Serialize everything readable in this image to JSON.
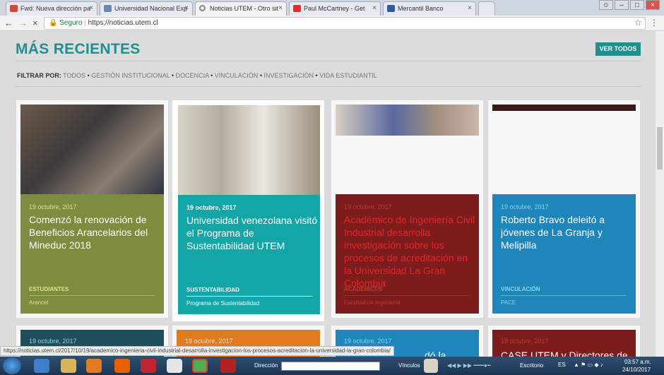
{
  "browser": {
    "tabs": [
      {
        "title": "Fwd: Nueva dirección pa",
        "icon": "gmail-icon",
        "color": "#d44638"
      },
      {
        "title": "Universidad Nacional Exp",
        "icon": "document-icon",
        "color": "#6b87b8"
      },
      {
        "title": "Noticias UTEM - Otro sit",
        "icon": "loading-icon",
        "color": "#888888"
      },
      {
        "title": "Paul McCartney - Get",
        "icon": "youtube-icon",
        "color": "#e52d27"
      },
      {
        "title": "Mercantil Banco",
        "icon": "bank-icon",
        "color": "#2f5d9a"
      }
    ],
    "secure_label": "Seguro",
    "url": "https://noticias.utem.cl",
    "status_url": "https://noticias.utem.cl/2017/10/19/academico-ingenieria-civil-industrial-desarrolla-investigacion-los-procesos-acreditacion-la-universidad-la-gran-colombia/"
  },
  "page": {
    "heading": "MÁS RECIENTES",
    "ver_todos": "VER TODOS",
    "filter_label": "FILTRAR POR:",
    "filters": [
      "TODOS",
      "GESTIÓN INSTITUCIONAL",
      "DOCENCIA",
      "VINCULACIÓN",
      "INVESTIGACIÓN",
      "VIDA ESTUDIANTIL"
    ],
    "separator": "•"
  },
  "cards": [
    {
      "date": "19 octubre, 2017",
      "title": "Comenzó la renovación de Beneficios Arancelarios del Mineduc 2018",
      "category": "ESTUDIANTES",
      "sub": "Arancel",
      "bg": "#7d8c3e",
      "date_color": "#e3e08e",
      "title_color": "#ffffff",
      "cat_color": "#e3e08e"
    },
    {
      "date": "19 octubre, 2017",
      "title": "Universidad venezolana visitó el Programa de Sustentabilidad UTEM",
      "category": "SUSTENTABILIDAD",
      "sub": "Programa de Sustentabilidad",
      "bg": "#14a6a6",
      "date_color": "#ffffff",
      "title_color": "#ffffff",
      "cat_color": "#ffffff"
    },
    {
      "date": "19 octubre, 2017",
      "title": "Académico de Ingeniería Civil Industrial desarrolla investigación sobre los procesos de acreditación en la Universidad La Gran Colombia",
      "category": "ACADÉMICOS",
      "sub": "Facultad de Ingeniería",
      "bg": "#7d1c1c",
      "date_color": "#c0392b",
      "title_color": "#e3262a",
      "cat_color": "#c0392b"
    },
    {
      "date": "19 octubre, 2017",
      "title": "Roberto Bravo deleitó a jóvenes de La Granja y Melipilla",
      "category": "VINCULACIÓN",
      "sub": "PACE",
      "bg": "#1f86b9",
      "date_color": "#8fd3f0",
      "title_color": "#ffffff",
      "cat_color": "#8fd3f0"
    }
  ],
  "cards_row2": [
    {
      "date": "19 octubre, 2017",
      "title": "",
      "bg": "#1f4f5a",
      "date_color": "#8fd3f0"
    },
    {
      "date": "19 octubre, 2017",
      "title": "",
      "bg": "#e07b1f",
      "date_color": "#fbe2c2"
    },
    {
      "date": "19 octubre, 2017",
      "title": "dó la",
      "bg": "#1f86b9",
      "date_color": "#8fd3f0"
    },
    {
      "date": "19 octubre, 2017",
      "title": "CASE UTEM y Directores de",
      "bg": "#7d1c1c",
      "date_color": "#c0392b"
    }
  ],
  "taskbar": {
    "direccion_label": "Dirección",
    "vinculos_label": "Vínculos",
    "escritorio_label": "Escritorio",
    "lang": "ES",
    "time": "03:57 a.m.",
    "date": "24/10/2017"
  }
}
